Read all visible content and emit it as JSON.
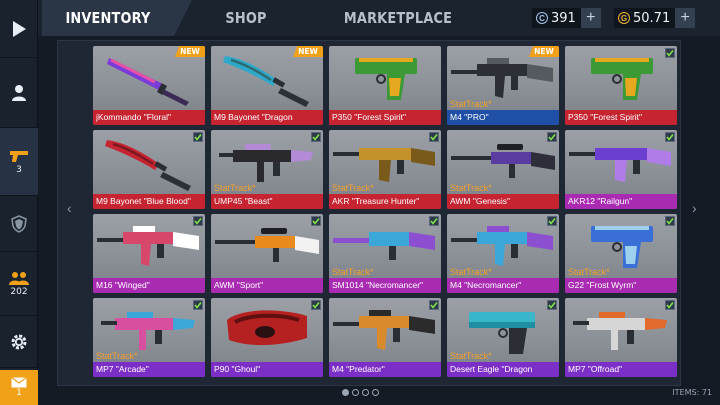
{
  "tabs": [
    {
      "label": "INVENTORY",
      "active": true
    },
    {
      "label": "SHOP",
      "active": false
    },
    {
      "label": "MARKETPLACE",
      "active": false
    }
  ],
  "currencies": {
    "silver": {
      "icon": "silver-coin-icon",
      "symbol": "C",
      "value": "391",
      "color": "#9fc3ea"
    },
    "gold": {
      "icon": "gold-coin-icon",
      "symbol": "G",
      "value": "50.71",
      "color": "#f2b233"
    }
  },
  "sidebar": {
    "weapons_count": "3",
    "friends_count": "202",
    "mail_count": "1"
  },
  "labels": {
    "new": "NEW",
    "stattrack": "StatTrack*"
  },
  "footer": {
    "items_count": "ITEMS: 71",
    "pages": 4,
    "current_page": 1
  },
  "items": [
    {
      "name": "jKommando \"Floral\"",
      "rarity": "red",
      "new": true,
      "equipped": false,
      "stattrack": false,
      "kind": "knife",
      "c1": "#7a3bd8",
      "c2": "#e84fa6"
    },
    {
      "name": "M9 Bayonet \"Dragon",
      "rarity": "red",
      "new": true,
      "equipped": false,
      "stattrack": false,
      "kind": "bayonet",
      "c1": "#2fa8c9",
      "c2": "#2c6b74"
    },
    {
      "name": "P350 \"Forest Spirit\"",
      "rarity": "red",
      "new": false,
      "equipped": false,
      "stattrack": false,
      "kind": "pistol",
      "c1": "#3b9a36",
      "c2": "#e6a81f"
    },
    {
      "name": "M4 \"PRO\"",
      "rarity": "blue",
      "new": true,
      "equipped": false,
      "stattrack": true,
      "kind": "rifle",
      "c1": "#2c2f35",
      "c2": "#555a61"
    },
    {
      "name": "P350 \"Forest Spirit\"",
      "rarity": "red",
      "new": false,
      "equipped": true,
      "stattrack": false,
      "kind": "pistol",
      "c1": "#3b9a36",
      "c2": "#e6a81f"
    },
    {
      "name": "M9 Bayonet \"Blue Blood\"",
      "rarity": "red",
      "new": false,
      "equipped": true,
      "stattrack": false,
      "kind": "bayonet",
      "c1": "#c52430",
      "c2": "#7d1820"
    },
    {
      "name": "UMP45 \"Beast\"",
      "rarity": "red",
      "new": false,
      "equipped": true,
      "stattrack": true,
      "kind": "smg",
      "c1": "#2a2a2e",
      "c2": "#b38ad6"
    },
    {
      "name": "AKR \"Treasure Hunter\"",
      "rarity": "red",
      "new": false,
      "equipped": true,
      "stattrack": true,
      "kind": "ak",
      "c1": "#c4922b",
      "c2": "#7a5a1a"
    },
    {
      "name": "AWM \"Genesis\"",
      "rarity": "red",
      "new": false,
      "equipped": true,
      "stattrack": true,
      "kind": "sniper",
      "c1": "#5a3ba0",
      "c2": "#2e2e3a"
    },
    {
      "name": "AKR12 \"Railgun\"",
      "rarity": "magenta",
      "new": false,
      "equipped": true,
      "stattrack": false,
      "kind": "ak",
      "c1": "#6b3fcf",
      "c2": "#b07de8"
    },
    {
      "name": "M16 \"Winged\"",
      "rarity": "magenta",
      "new": false,
      "equipped": true,
      "stattrack": false,
      "kind": "rifle",
      "c1": "#d6476a",
      "c2": "#ffffff"
    },
    {
      "name": "AWM \"Sport\"",
      "rarity": "magenta",
      "new": false,
      "equipped": true,
      "stattrack": false,
      "kind": "sniper",
      "c1": "#e98a1c",
      "c2": "#f2f2f2"
    },
    {
      "name": "SM1014 \"Necromancer\"",
      "rarity": "magenta",
      "new": false,
      "equipped": true,
      "stattrack": true,
      "kind": "shotgun",
      "c1": "#3ba7d9",
      "c2": "#8b4fd0"
    },
    {
      "name": "M4 \"Necromancer\"",
      "rarity": "magenta",
      "new": false,
      "equipped": true,
      "stattrack": true,
      "kind": "rifle",
      "c1": "#3ba7d9",
      "c2": "#8b4fd0"
    },
    {
      "name": "G22 \"Frost Wyrm\"",
      "rarity": "magenta",
      "new": false,
      "equipped": true,
      "stattrack": true,
      "kind": "pistol",
      "c1": "#3a6fd8",
      "c2": "#9ed1ee"
    },
    {
      "name": "MP7 \"Arcade\"",
      "rarity": "purple",
      "new": false,
      "equipped": true,
      "stattrack": true,
      "kind": "smg",
      "c1": "#d94fa0",
      "c2": "#3ba7d9"
    },
    {
      "name": "P90 \"Ghoul\"",
      "rarity": "purple",
      "new": false,
      "equipped": true,
      "stattrack": false,
      "kind": "p90",
      "c1": "#b52020",
      "c2": "#5e0f0f"
    },
    {
      "name": "M4 \"Predator\"",
      "rarity": "purple",
      "new": false,
      "equipped": true,
      "stattrack": false,
      "kind": "rifle",
      "c1": "#d98a2a",
      "c2": "#2b2b2b"
    },
    {
      "name": "Desert Eagle \"Dragon",
      "rarity": "purple",
      "new": false,
      "equipped": true,
      "stattrack": true,
      "kind": "deagle",
      "c1": "#39b6c9",
      "c2": "#2a2d33"
    },
    {
      "name": "MP7 \"Offroad\"",
      "rarity": "purple",
      "new": false,
      "equipped": true,
      "stattrack": false,
      "kind": "smg",
      "c1": "#d6d6d6",
      "c2": "#e26a2c"
    }
  ]
}
